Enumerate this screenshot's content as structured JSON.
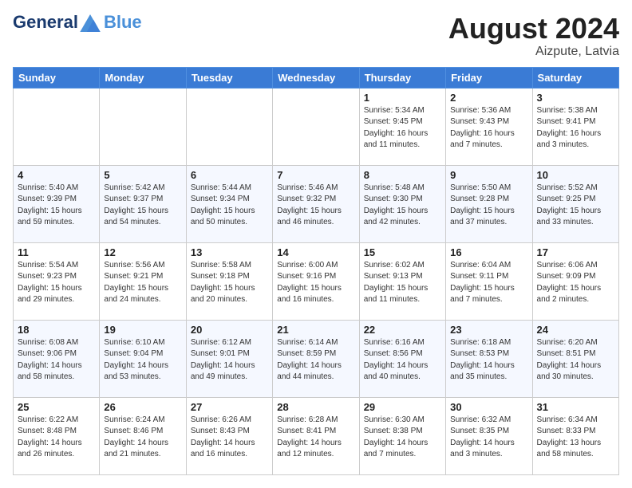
{
  "header": {
    "logo_line1": "General",
    "logo_line2": "Blue",
    "month_year": "August 2024",
    "location": "Aizpute, Latvia"
  },
  "days_of_week": [
    "Sunday",
    "Monday",
    "Tuesday",
    "Wednesday",
    "Thursday",
    "Friday",
    "Saturday"
  ],
  "weeks": [
    [
      {
        "day": "",
        "info": ""
      },
      {
        "day": "",
        "info": ""
      },
      {
        "day": "",
        "info": ""
      },
      {
        "day": "",
        "info": ""
      },
      {
        "day": "1",
        "info": "Sunrise: 5:34 AM\nSunset: 9:45 PM\nDaylight: 16 hours\nand 11 minutes."
      },
      {
        "day": "2",
        "info": "Sunrise: 5:36 AM\nSunset: 9:43 PM\nDaylight: 16 hours\nand 7 minutes."
      },
      {
        "day": "3",
        "info": "Sunrise: 5:38 AM\nSunset: 9:41 PM\nDaylight: 16 hours\nand 3 minutes."
      }
    ],
    [
      {
        "day": "4",
        "info": "Sunrise: 5:40 AM\nSunset: 9:39 PM\nDaylight: 15 hours\nand 59 minutes."
      },
      {
        "day": "5",
        "info": "Sunrise: 5:42 AM\nSunset: 9:37 PM\nDaylight: 15 hours\nand 54 minutes."
      },
      {
        "day": "6",
        "info": "Sunrise: 5:44 AM\nSunset: 9:34 PM\nDaylight: 15 hours\nand 50 minutes."
      },
      {
        "day": "7",
        "info": "Sunrise: 5:46 AM\nSunset: 9:32 PM\nDaylight: 15 hours\nand 46 minutes."
      },
      {
        "day": "8",
        "info": "Sunrise: 5:48 AM\nSunset: 9:30 PM\nDaylight: 15 hours\nand 42 minutes."
      },
      {
        "day": "9",
        "info": "Sunrise: 5:50 AM\nSunset: 9:28 PM\nDaylight: 15 hours\nand 37 minutes."
      },
      {
        "day": "10",
        "info": "Sunrise: 5:52 AM\nSunset: 9:25 PM\nDaylight: 15 hours\nand 33 minutes."
      }
    ],
    [
      {
        "day": "11",
        "info": "Sunrise: 5:54 AM\nSunset: 9:23 PM\nDaylight: 15 hours\nand 29 minutes."
      },
      {
        "day": "12",
        "info": "Sunrise: 5:56 AM\nSunset: 9:21 PM\nDaylight: 15 hours\nand 24 minutes."
      },
      {
        "day": "13",
        "info": "Sunrise: 5:58 AM\nSunset: 9:18 PM\nDaylight: 15 hours\nand 20 minutes."
      },
      {
        "day": "14",
        "info": "Sunrise: 6:00 AM\nSunset: 9:16 PM\nDaylight: 15 hours\nand 16 minutes."
      },
      {
        "day": "15",
        "info": "Sunrise: 6:02 AM\nSunset: 9:13 PM\nDaylight: 15 hours\nand 11 minutes."
      },
      {
        "day": "16",
        "info": "Sunrise: 6:04 AM\nSunset: 9:11 PM\nDaylight: 15 hours\nand 7 minutes."
      },
      {
        "day": "17",
        "info": "Sunrise: 6:06 AM\nSunset: 9:09 PM\nDaylight: 15 hours\nand 2 minutes."
      }
    ],
    [
      {
        "day": "18",
        "info": "Sunrise: 6:08 AM\nSunset: 9:06 PM\nDaylight: 14 hours\nand 58 minutes."
      },
      {
        "day": "19",
        "info": "Sunrise: 6:10 AM\nSunset: 9:04 PM\nDaylight: 14 hours\nand 53 minutes."
      },
      {
        "day": "20",
        "info": "Sunrise: 6:12 AM\nSunset: 9:01 PM\nDaylight: 14 hours\nand 49 minutes."
      },
      {
        "day": "21",
        "info": "Sunrise: 6:14 AM\nSunset: 8:59 PM\nDaylight: 14 hours\nand 44 minutes."
      },
      {
        "day": "22",
        "info": "Sunrise: 6:16 AM\nSunset: 8:56 PM\nDaylight: 14 hours\nand 40 minutes."
      },
      {
        "day": "23",
        "info": "Sunrise: 6:18 AM\nSunset: 8:53 PM\nDaylight: 14 hours\nand 35 minutes."
      },
      {
        "day": "24",
        "info": "Sunrise: 6:20 AM\nSunset: 8:51 PM\nDaylight: 14 hours\nand 30 minutes."
      }
    ],
    [
      {
        "day": "25",
        "info": "Sunrise: 6:22 AM\nSunset: 8:48 PM\nDaylight: 14 hours\nand 26 minutes."
      },
      {
        "day": "26",
        "info": "Sunrise: 6:24 AM\nSunset: 8:46 PM\nDaylight: 14 hours\nand 21 minutes."
      },
      {
        "day": "27",
        "info": "Sunrise: 6:26 AM\nSunset: 8:43 PM\nDaylight: 14 hours\nand 16 minutes."
      },
      {
        "day": "28",
        "info": "Sunrise: 6:28 AM\nSunset: 8:41 PM\nDaylight: 14 hours\nand 12 minutes."
      },
      {
        "day": "29",
        "info": "Sunrise: 6:30 AM\nSunset: 8:38 PM\nDaylight: 14 hours\nand 7 minutes."
      },
      {
        "day": "30",
        "info": "Sunrise: 6:32 AM\nSunset: 8:35 PM\nDaylight: 14 hours\nand 3 minutes."
      },
      {
        "day": "31",
        "info": "Sunrise: 6:34 AM\nSunset: 8:33 PM\nDaylight: 13 hours\nand 58 minutes."
      }
    ]
  ]
}
